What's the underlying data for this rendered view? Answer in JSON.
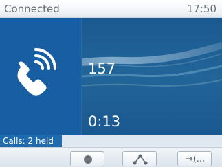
{
  "status": {
    "connection": "Connected",
    "time": "17:50"
  },
  "call": {
    "number": "157",
    "duration": "0:13"
  },
  "calls_bar": {
    "label": "Calls: 2 held"
  },
  "softkeys": [
    {
      "icon": "record-dot-icon"
    },
    {
      "icon": "conference-icon"
    },
    {
      "icon": "transfer-call-icon",
      "label": "→(..."
    }
  ],
  "colors": {
    "call_background": "#1f5d92",
    "icon_panel": "#185ea3",
    "calls_label": "#1e6bb0",
    "status_text": "#6a6f75"
  }
}
